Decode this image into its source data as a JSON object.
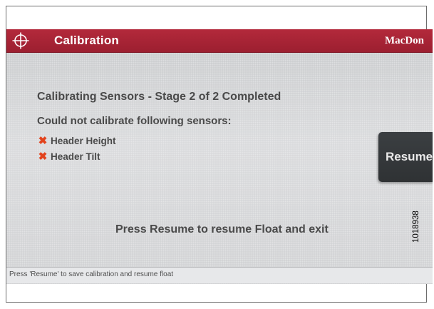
{
  "titlebar": {
    "title": "Calibration",
    "brand": "MacDon",
    "icon": "crosshair-icon",
    "color": "#a52233"
  },
  "main": {
    "heading": "Calibrating Sensors - Stage 2 of 2 Completed",
    "subheading": "Could not calibrate following sensors:",
    "failed_sensors": [
      {
        "icon": "error-x-icon",
        "symbol": "✖",
        "label": "Header Height"
      },
      {
        "icon": "error-x-icon",
        "symbol": "✖",
        "label": "Header Tilt"
      }
    ],
    "resume_button": "Resume",
    "instruction": "Press Resume to resume Float and exit"
  },
  "statusbar": {
    "text": "Press 'Resume' to save calibration and resume float"
  },
  "figure_id": "1018938"
}
